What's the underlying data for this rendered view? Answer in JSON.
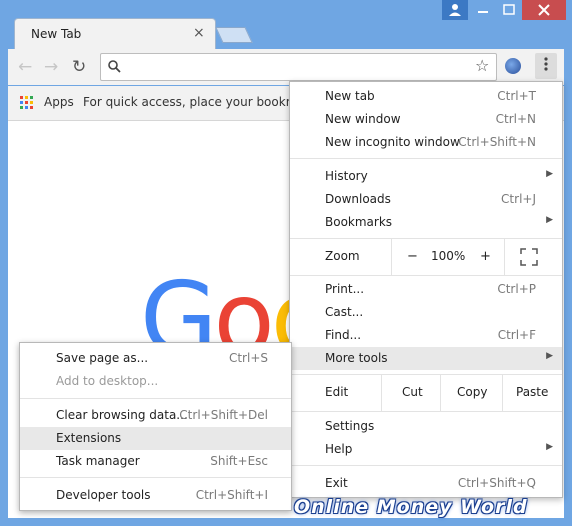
{
  "window": {
    "tab_title": "New Tab",
    "tab_close": "×",
    "caption": {
      "user_icon": "person-icon",
      "minimize": "—",
      "maximize": "□",
      "close": "✕"
    }
  },
  "toolbar": {
    "back": "←",
    "forward": "→",
    "reload": "↻",
    "search_glyph": "⌕",
    "star": "☆",
    "menu_dots": "⋮",
    "omnibox_value": ""
  },
  "bookmarks": {
    "apps_label": "Apps",
    "hint": "For quick access, place your bookmarks"
  },
  "page": {
    "logo_letters": [
      "G",
      "o",
      "o"
    ],
    "logo_colors": [
      "#4285f4",
      "#ea4335",
      "#fbbc05"
    ]
  },
  "main_menu": {
    "new_tab": {
      "label": "New tab",
      "shortcut": "Ctrl+T"
    },
    "new_window": {
      "label": "New window",
      "shortcut": "Ctrl+N"
    },
    "new_incognito": {
      "label": "New incognito window",
      "shortcut": "Ctrl+Shift+N"
    },
    "history": {
      "label": "History"
    },
    "downloads": {
      "label": "Downloads",
      "shortcut": "Ctrl+J"
    },
    "bookmarks": {
      "label": "Bookmarks"
    },
    "zoom": {
      "label": "Zoom",
      "minus": "−",
      "value": "100%",
      "plus": "+",
      "fullscreen": "⛶"
    },
    "print": {
      "label": "Print...",
      "shortcut": "Ctrl+P"
    },
    "cast": {
      "label": "Cast..."
    },
    "find": {
      "label": "Find...",
      "shortcut": "Ctrl+F"
    },
    "more_tools": {
      "label": "More tools"
    },
    "edit": {
      "label": "Edit",
      "cut": "Cut",
      "copy": "Copy",
      "paste": "Paste"
    },
    "settings": {
      "label": "Settings"
    },
    "help": {
      "label": "Help"
    },
    "exit": {
      "label": "Exit",
      "shortcut": "Ctrl+Shift+Q"
    },
    "arrow": "▶"
  },
  "sub_menu": {
    "save_page": {
      "label": "Save page as...",
      "shortcut": "Ctrl+S"
    },
    "add_desktop": {
      "label": "Add to desktop..."
    },
    "clear_data": {
      "label": "Clear browsing data...",
      "shortcut": "Ctrl+Shift+Del"
    },
    "extensions": {
      "label": "Extensions"
    },
    "task_manager": {
      "label": "Task manager",
      "shortcut": "Shift+Esc"
    },
    "dev_tools": {
      "label": "Developer tools",
      "shortcut": "Ctrl+Shift+I"
    }
  },
  "watermark": {
    "text": "Online Money World"
  },
  "colors": {
    "accent_frame": "#6fa6e3",
    "close_red": "#c84d4f",
    "highlight": "#e8e8e8"
  }
}
